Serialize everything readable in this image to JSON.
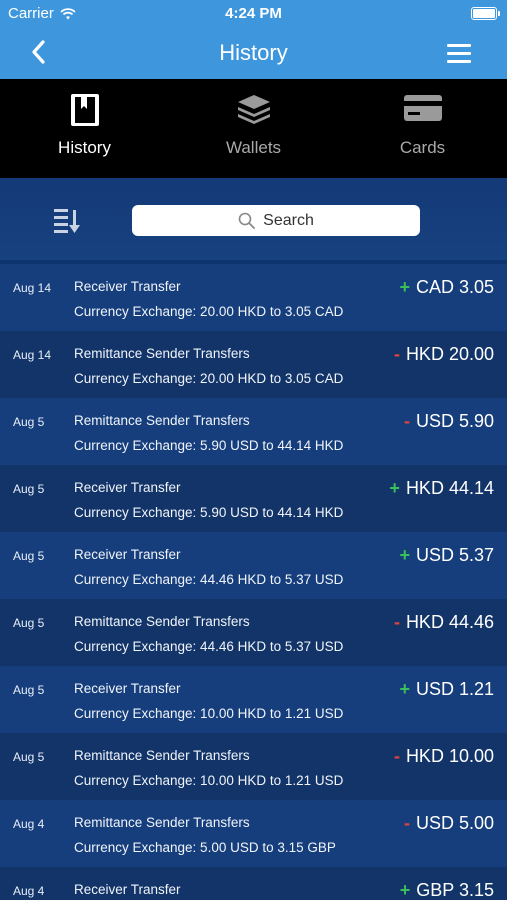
{
  "status_bar": {
    "carrier": "Carrier",
    "time": "4:24 PM"
  },
  "navbar": {
    "title": "History"
  },
  "tabs": [
    {
      "label": "History",
      "icon": "book-icon",
      "active": true
    },
    {
      "label": "Wallets",
      "icon": "stack-icon",
      "active": false
    },
    {
      "label": "Cards",
      "icon": "card-icon",
      "active": false
    }
  ],
  "search": {
    "placeholder": "Search"
  },
  "colors": {
    "nav_blue": "#3e97dd",
    "background": "#0f3570",
    "positive": "#38c05a",
    "negative": "#e1423b"
  },
  "transactions": [
    {
      "date": "Aug 14",
      "title": "Receiver Transfer",
      "detail": "Currency Exchange: 20.00 HKD to 3.05 CAD",
      "sign": "+",
      "amount": "CAD 3.05"
    },
    {
      "date": "Aug 14",
      "title": "Remittance Sender Transfers",
      "detail": "Currency Exchange: 20.00 HKD to 3.05 CAD",
      "sign": "-",
      "amount": "HKD 20.00"
    },
    {
      "date": "Aug 5",
      "title": "Remittance Sender Transfers",
      "detail": "Currency Exchange: 5.90 USD to 44.14 HKD",
      "sign": "-",
      "amount": "USD 5.90"
    },
    {
      "date": "Aug 5",
      "title": "Receiver Transfer",
      "detail": "Currency Exchange: 5.90 USD to 44.14 HKD",
      "sign": "+",
      "amount": "HKD 44.14"
    },
    {
      "date": "Aug 5",
      "title": "Receiver Transfer",
      "detail": "Currency Exchange: 44.46 HKD to 5.37 USD",
      "sign": "+",
      "amount": "USD 5.37"
    },
    {
      "date": "Aug 5",
      "title": "Remittance Sender Transfers",
      "detail": "Currency Exchange: 44.46 HKD to 5.37 USD",
      "sign": "-",
      "amount": "HKD 44.46"
    },
    {
      "date": "Aug 5",
      "title": "Receiver Transfer",
      "detail": "Currency Exchange: 10.00 HKD to 1.21 USD",
      "sign": "+",
      "amount": "USD 1.21"
    },
    {
      "date": "Aug 5",
      "title": "Remittance Sender Transfers",
      "detail": "Currency Exchange: 10.00 HKD to 1.21 USD",
      "sign": "-",
      "amount": "HKD 10.00"
    },
    {
      "date": "Aug 4",
      "title": "Remittance Sender Transfers",
      "detail": "Currency Exchange: 5.00 USD to 3.15 GBP",
      "sign": "-",
      "amount": "USD 5.00"
    },
    {
      "date": "Aug 4",
      "title": "Receiver Transfer",
      "detail": "",
      "sign": "+",
      "amount": "GBP 3.15"
    }
  ]
}
